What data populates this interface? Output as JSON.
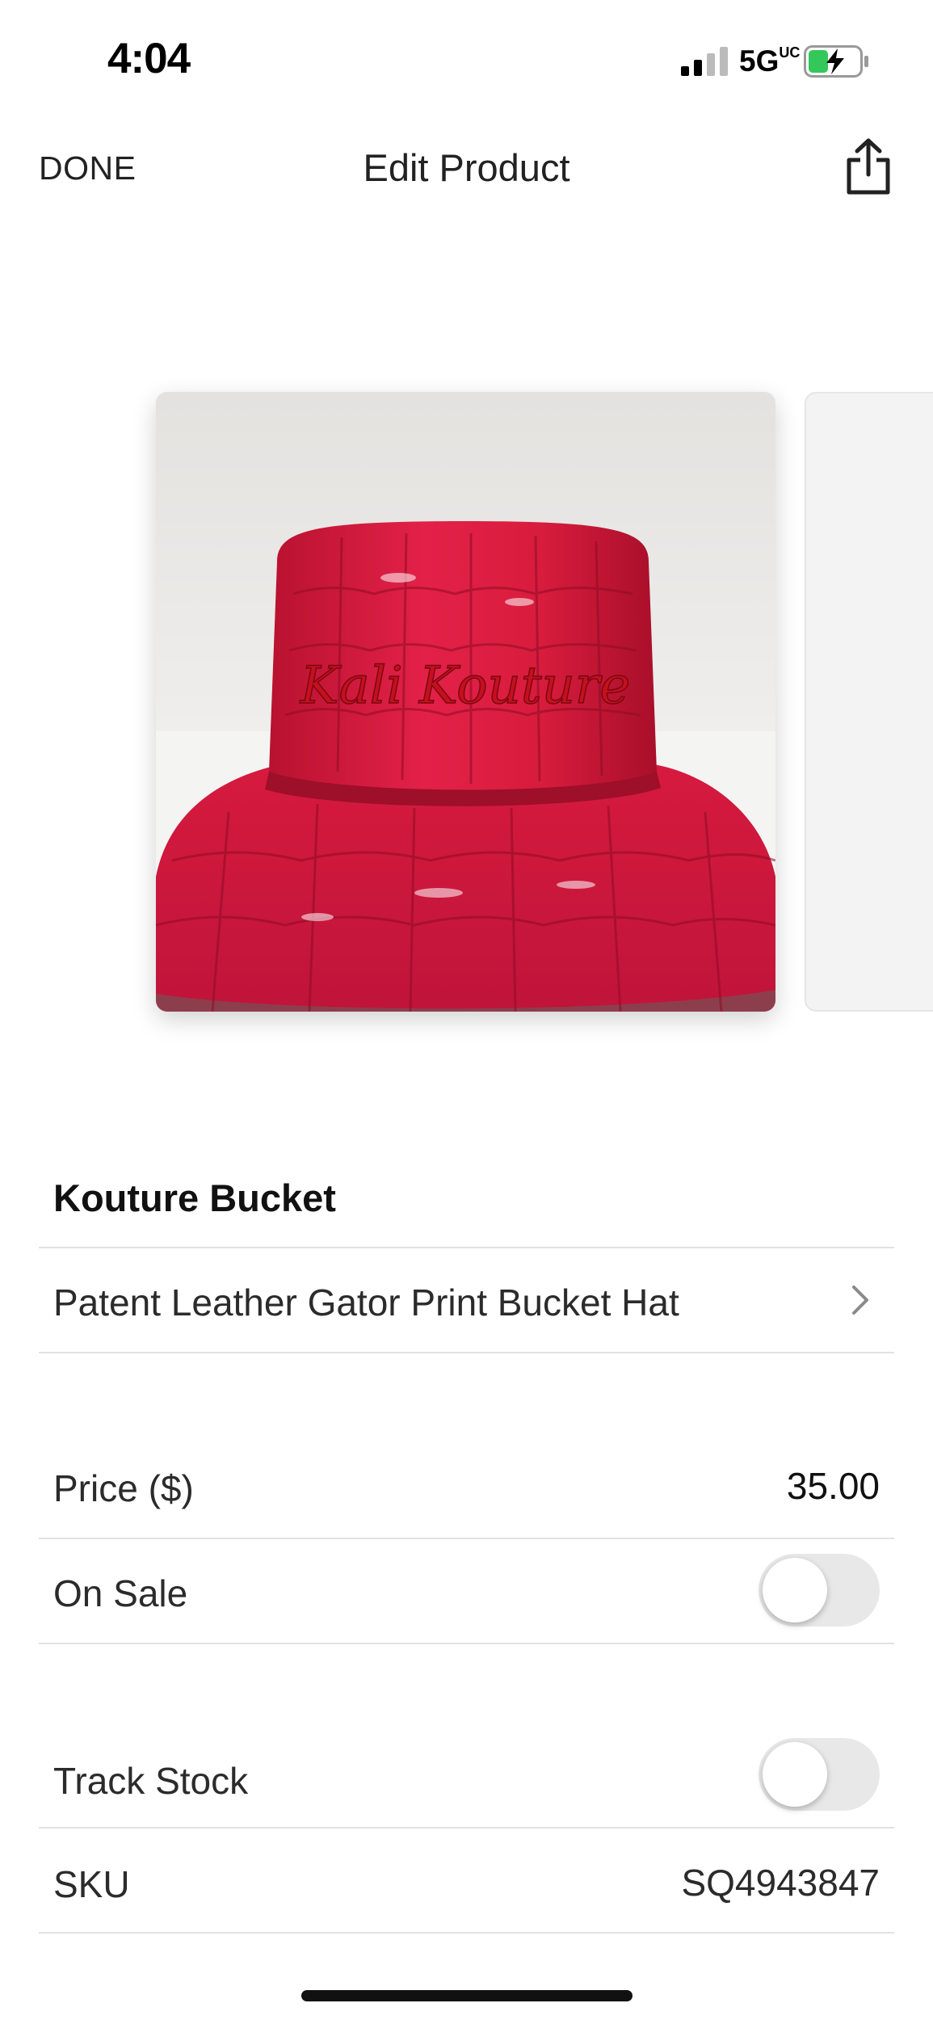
{
  "status_bar": {
    "time": "4:04",
    "network": "5G",
    "network_suffix": "UC",
    "battery_icon": "battery-charging-icon",
    "signal_icon": "signal-icon"
  },
  "nav": {
    "done_label": "DONE",
    "title": "Edit Product",
    "share_icon": "share-icon"
  },
  "gallery": {
    "image_alt": "Red patent leather gator print bucket hat with Kali Kouture embroidery",
    "embroidery_text": "Kali Kouture"
  },
  "product": {
    "name": "Kouture Bucket",
    "description": "Patent Leather Gator Print Bucket Hat"
  },
  "pricing": {
    "price_label": "Price ($)",
    "price_value": "35.00",
    "on_sale_label": "On Sale",
    "on_sale": false
  },
  "inventory": {
    "track_stock_label": "Track Stock",
    "track_stock": false,
    "sku_label": "SKU",
    "sku_value": "SQ4943847"
  },
  "colors": {
    "toggle_off": "#e8e8e8",
    "hat_red": "#d81c3d"
  }
}
